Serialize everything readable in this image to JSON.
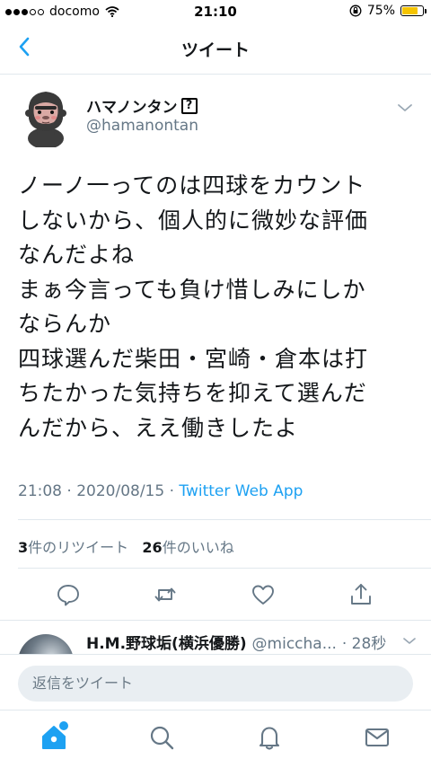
{
  "status_bar": {
    "carrier": "docomo",
    "time": "21:10",
    "battery_percent": "75%",
    "battery_level": 0.75,
    "signal_bars_filled": 3,
    "signal_bars_total": 5
  },
  "nav": {
    "title": "ツイート",
    "back_icon": "chevron-left-icon"
  },
  "tweet": {
    "display_name": "ハマノンタン",
    "name_emoji_placeholder": "?",
    "handle": "@hamanontan",
    "body": "ノーノ一ってのは四球をカウント\nしないから、個人的に微妙な評価\nなんだよね\nまぁ今言っても負け惜しみにしか\nならんか\n四球選んだ柴田・宮崎・倉本は打\nちたかった気持ちを抑えて選んだ\nんだから、ええ働きしたよ",
    "timestamp": "21:08 · 2020/08/15 · ",
    "source_app": "Twitter Web App"
  },
  "stats": {
    "retweet_count": "3",
    "retweet_label": "件のリツイート",
    "like_count": "26",
    "like_label": "件のいいね"
  },
  "actions": [
    "reply-icon",
    "retweet-icon",
    "like-icon",
    "share-icon"
  ],
  "reply_preview": {
    "display_name": "H.M.野球垢(横浜優勝)",
    "handle": "@miccha...",
    "time": "· 28秒"
  },
  "compose": {
    "placeholder": "返信をツイート"
  },
  "tabs": [
    "home-icon",
    "search-icon",
    "notifications-icon",
    "messages-icon"
  ],
  "colors": {
    "accent": "#1da1f2",
    "secondary_text": "#657786",
    "battery": "#f5c400"
  }
}
